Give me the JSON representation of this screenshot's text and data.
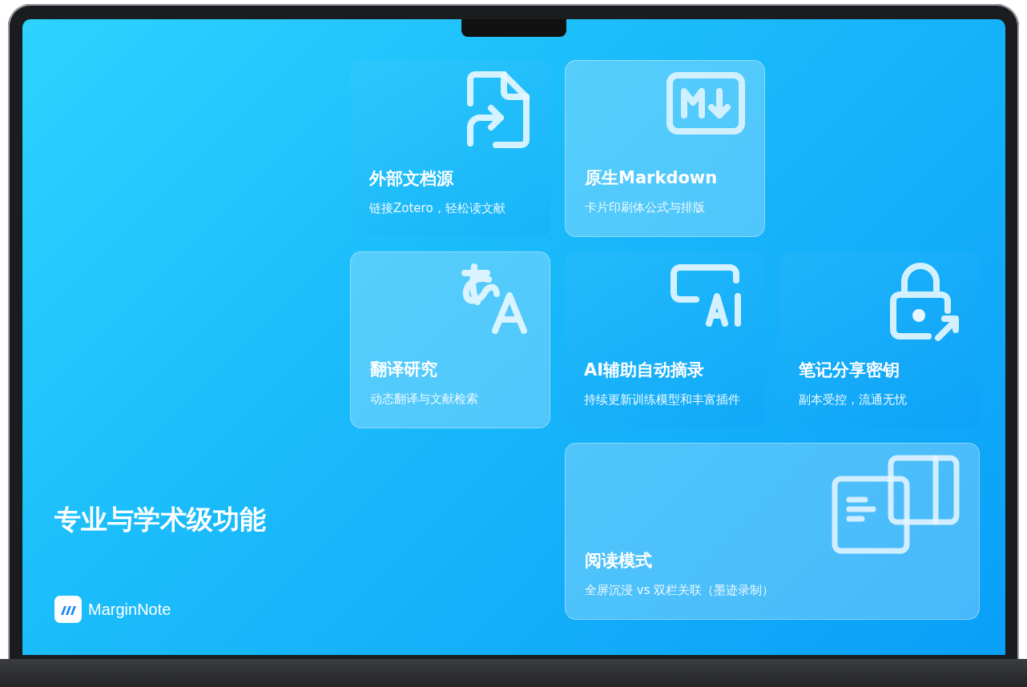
{
  "slide": {
    "heading": "专业与学术级功能",
    "brand": {
      "name": "MarginNote"
    },
    "cards": [
      {
        "kind": "plain",
        "title": "外部文档源",
        "subtitle": "链接Zotero，轻松读文献"
      },
      {
        "kind": "frosted",
        "title": "原生Markdown",
        "subtitle": "卡片印刷体公式与排版"
      },
      {
        "kind": "frosted",
        "title": "翻译研究",
        "subtitle": "动态翻译与文献检索"
      },
      {
        "kind": "plain",
        "title": "AI辅助自动摘录",
        "subtitle": "持续更新训练模型和丰富插件"
      },
      {
        "kind": "plain",
        "title": "笔记分享密钥",
        "subtitle": "副本受控，流通无忧"
      },
      {
        "kind": "frosted",
        "title": "阅读模式",
        "subtitle": "全屏沉浸 vs 双栏关联（墨迹录制）"
      }
    ]
  }
}
